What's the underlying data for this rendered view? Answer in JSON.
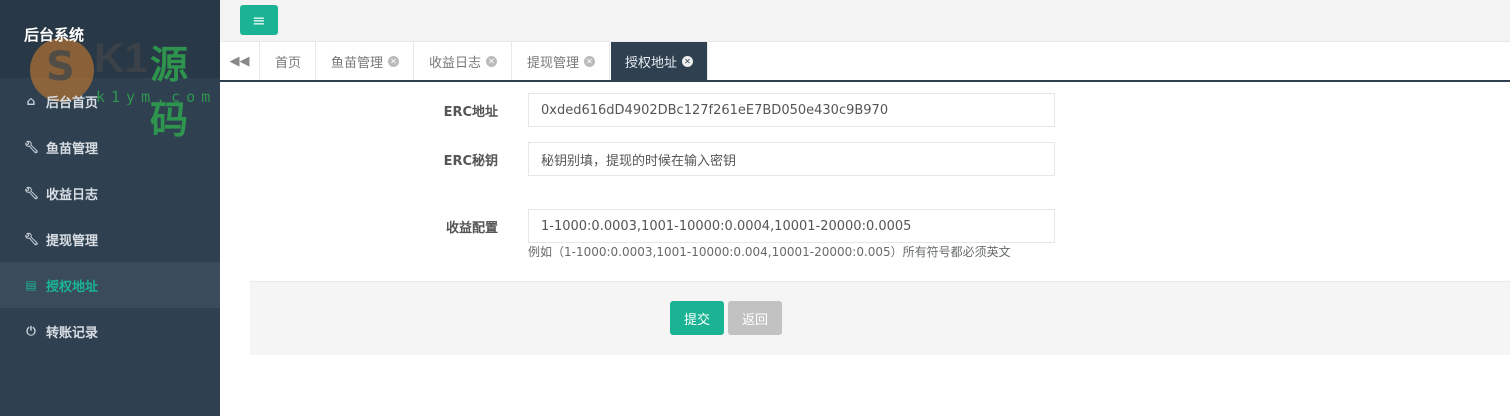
{
  "sidebar": {
    "brand": "后台系统",
    "watermark": {
      "k1": "K1",
      "yuanma": "源码",
      "url": "k1ym.com"
    },
    "items": [
      {
        "label": "后台首页",
        "icon": "home-icon",
        "active": false
      },
      {
        "label": "鱼苗管理",
        "icon": "wrench-icon",
        "active": false
      },
      {
        "label": "收益日志",
        "icon": "wrench-icon",
        "active": false
      },
      {
        "label": "提现管理",
        "icon": "wrench-icon",
        "active": false
      },
      {
        "label": "授权地址",
        "icon": "file-icon",
        "active": true
      },
      {
        "label": "转账记录",
        "icon": "power-icon",
        "active": false
      }
    ]
  },
  "tabs": [
    {
      "label": "首页",
      "closable": false
    },
    {
      "label": "鱼苗管理",
      "closable": true
    },
    {
      "label": "收益日志",
      "closable": true
    },
    {
      "label": "提现管理",
      "closable": true
    },
    {
      "label": "授权地址",
      "closable": true,
      "active": true
    }
  ],
  "form": {
    "erc_address": {
      "label": "ERC地址",
      "value": "0xded616dD4902DBc127f261eE7BD050e430c9B970"
    },
    "erc_secret": {
      "label": "ERC秘钥",
      "value": "秘钥别填，提现的时候在输入密钥"
    },
    "income_config": {
      "label": "收益配置",
      "value": "1-1000:0.0003,1001-10000:0.0004,10001-20000:0.0005",
      "help": "例如（1-1000:0.0003,1001-10000:0.004,10001-20000:0.005）所有符号都必须英文"
    }
  },
  "actions": {
    "submit": "提交",
    "back": "返回"
  },
  "colors": {
    "sidebar": "#2f4050",
    "accent": "#1ab394",
    "back_button": "#c2c2c2"
  }
}
